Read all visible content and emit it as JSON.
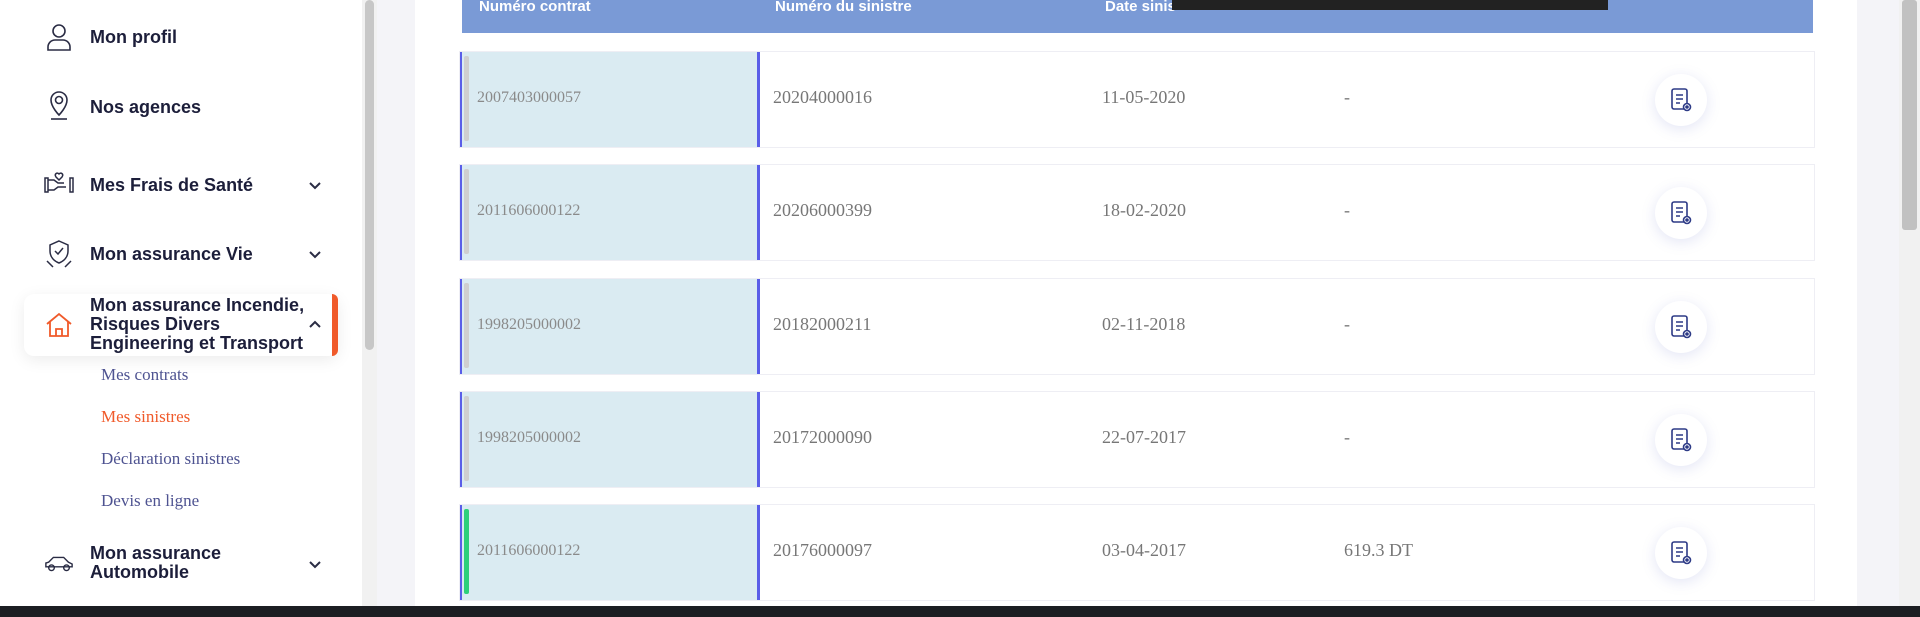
{
  "sidebar": {
    "items": [
      {
        "label": "Mon profil",
        "icon": "user-icon"
      },
      {
        "label": "Nos agences",
        "icon": "map-pin-icon"
      },
      {
        "label": "Mes Frais de Santé",
        "icon": "health-hands-icon"
      },
      {
        "label": "Mon assurance Vie",
        "icon": "life-insurance-icon"
      },
      {
        "label": "Mon assurance Incendie, Risques Divers Engineering et Transport",
        "icon": "home-icon"
      },
      {
        "label": "Mon assurance Automobile",
        "icon": "car-icon"
      }
    ],
    "sub_items": [
      "Mes contrats",
      "Mes sinistres",
      "Déclaration sinistres",
      "Devis en ligne"
    ],
    "active_sub": "Mes sinistres"
  },
  "table": {
    "headers": [
      "Numéro contrat",
      "Numéro du sinistre",
      "Date sinis"
    ],
    "rows": [
      {
        "contrat": "2007403000057",
        "sinistre": "20204000016",
        "date": "11-05-2020",
        "montant": "-",
        "status": "grey"
      },
      {
        "contrat": "2011606000122",
        "sinistre": "20206000399",
        "date": "18-02-2020",
        "montant": "-",
        "status": "grey"
      },
      {
        "contrat": "1998205000002",
        "sinistre": "20182000211",
        "date": "02-11-2018",
        "montant": "-",
        "status": "grey"
      },
      {
        "contrat": "1998205000002",
        "sinistre": "20172000090",
        "date": "22-07-2017",
        "montant": "-",
        "status": "grey"
      },
      {
        "contrat": "2011606000122",
        "sinistre": "20176000097",
        "date": "03-04-2017",
        "montant": "619.3 DT",
        "status": "green"
      }
    ],
    "action_icon": "document-view-icon"
  },
  "colors": {
    "accent": "#f05a2a",
    "header": "#7a9ad6",
    "cell_highlight": "#daebf2",
    "status_ok": "#2ed07a",
    "nav_text": "#1c1e3a",
    "sub_text": "#4e5391"
  }
}
